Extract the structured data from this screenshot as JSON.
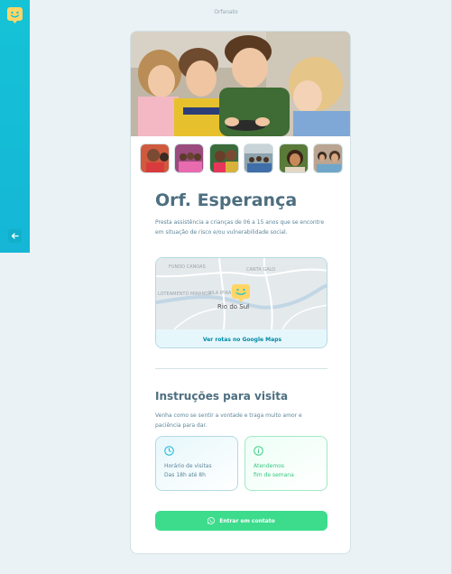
{
  "page": {
    "label": "Orfanato"
  },
  "sidebar": {
    "logo_icon": "happy-face-logo",
    "back_icon": "arrow-left-icon"
  },
  "orphanage": {
    "name": "Orf. Esperança",
    "description": "Presta assistência a crianças de 06 a 15 anos que se encontre em situação de risco e/ou vulnerabilidade social.",
    "images": [
      "hero-children-photo",
      "thumb-1",
      "thumb-2",
      "thumb-3",
      "thumb-4",
      "thumb-5",
      "thumb-6"
    ]
  },
  "map": {
    "labels": {
      "fundo_canoas": "FUNDO CANOAS",
      "canta_galo": "CANTA GALO",
      "loteamento_miranda": "LOTEAMENTO MIRANDA",
      "vila_ipiranga": "VILA IPIRANGA",
      "rio_do_sul": "Rio do Sul"
    },
    "link_label": "Ver rotas no Google Maps"
  },
  "visit": {
    "title": "Instruções para visita",
    "instructions": "Venha como se sentir a vontade e traga muito amor e paciência para dar.",
    "hours": {
      "line1": "Horário de visitas",
      "line2": "Das 18h até 8h",
      "icon": "clock-icon"
    },
    "weekend": {
      "line1": "Atendemos",
      "line2": "fim de semana",
      "icon": "info-icon"
    }
  },
  "contact": {
    "label": "Entrar em contato",
    "icon": "whatsapp-icon"
  },
  "colors": {
    "sidebar": "#15c3d6",
    "accent_green": "#3cdc8c",
    "text": "#4d6f80",
    "logo": "#ffd666"
  }
}
